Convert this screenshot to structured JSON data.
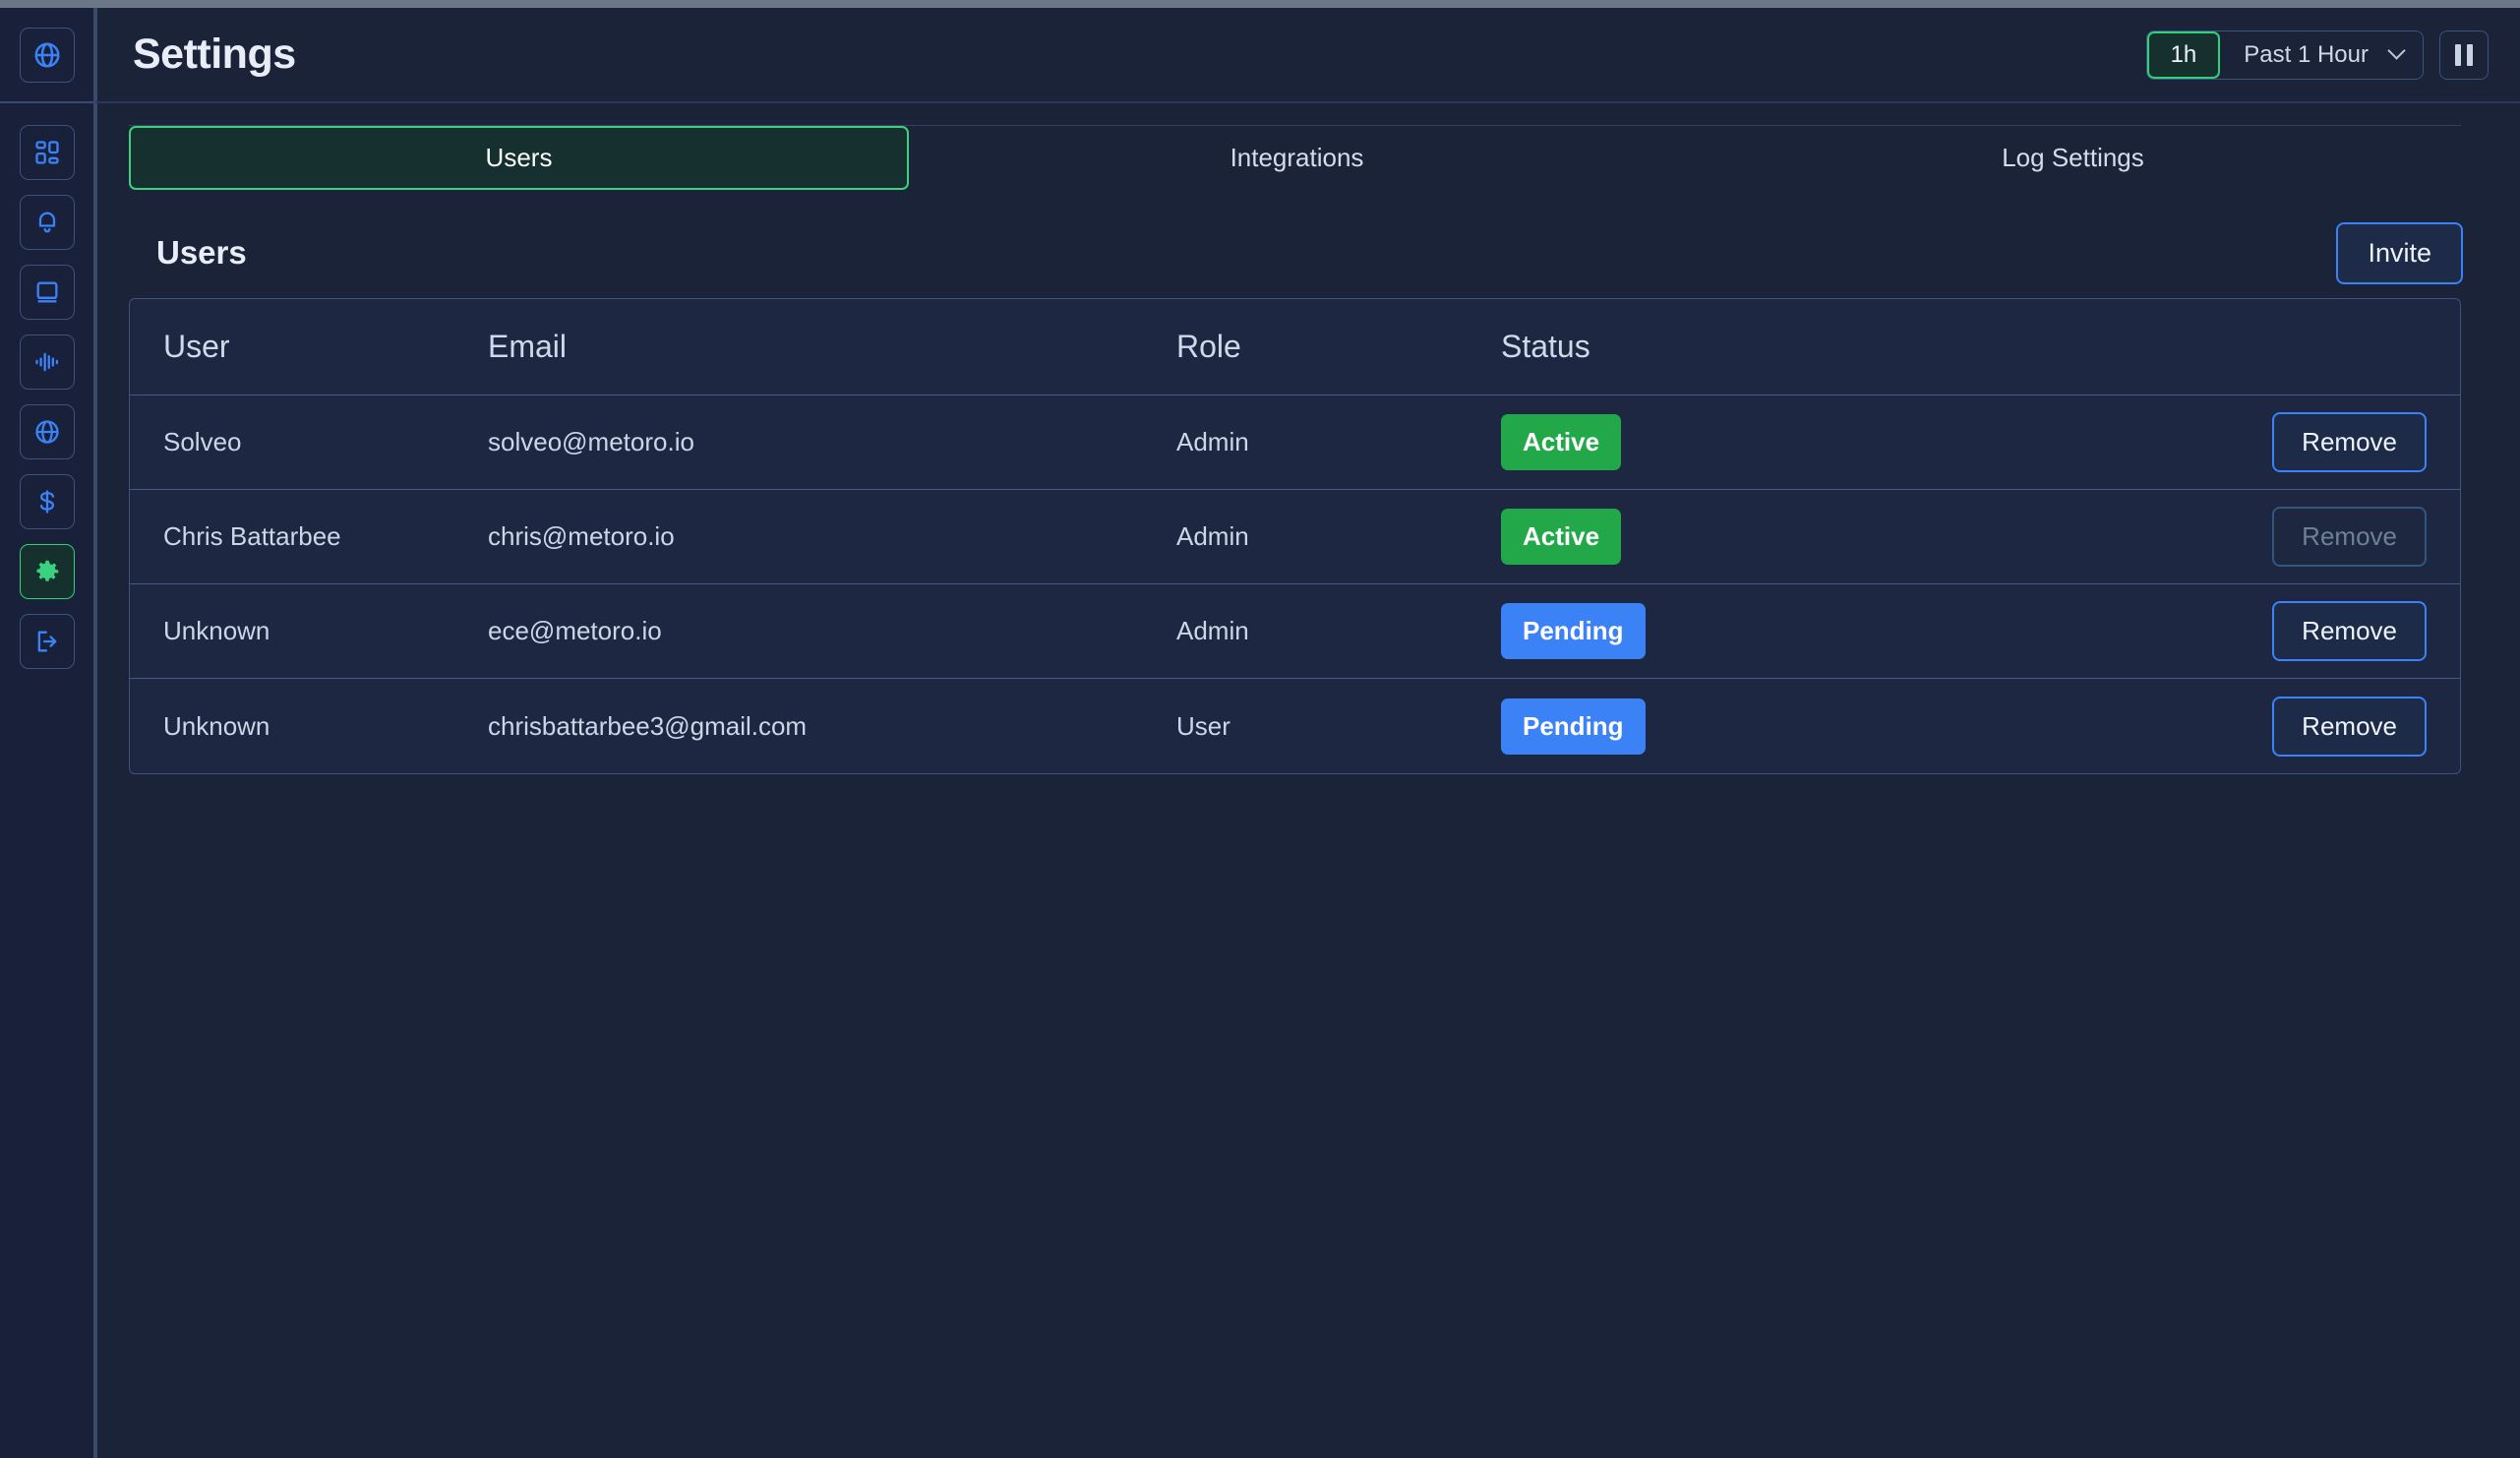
{
  "header": {
    "title": "Settings",
    "timerange": {
      "badge": "1h",
      "label": "Past 1 Hour",
      "chevron_icon": "chevron-down-icon"
    },
    "pause_icon": "pause-icon"
  },
  "sidebar": {
    "logo_icon": "globe-icon",
    "items": [
      {
        "icon": "dashboard-grid-icon",
        "active": false
      },
      {
        "icon": "bell-icon",
        "active": false
      },
      {
        "icon": "book-icon",
        "active": false
      },
      {
        "icon": "waveform-icon",
        "active": false
      },
      {
        "icon": "globe-icon",
        "active": false
      },
      {
        "icon": "dollar-icon",
        "active": false
      },
      {
        "icon": "gear-icon",
        "active": true
      },
      {
        "icon": "logout-icon",
        "active": false
      }
    ]
  },
  "tabs": [
    {
      "label": "Users",
      "active": true
    },
    {
      "label": "Integrations",
      "active": false
    },
    {
      "label": "Log Settings",
      "active": false
    }
  ],
  "section": {
    "title": "Users",
    "invite_label": "Invite"
  },
  "table": {
    "columns": [
      "User",
      "Email",
      "Role",
      "Status"
    ],
    "action_label": "Remove",
    "rows": [
      {
        "user": "Solveo",
        "email": "solveo@metoro.io",
        "role": "Admin",
        "status": "Active",
        "status_kind": "active",
        "action": "Remove",
        "action_disabled": false
      },
      {
        "user": "Chris Battarbee",
        "email": "chris@metoro.io",
        "role": "Admin",
        "status": "Active",
        "status_kind": "active",
        "action": "Remove",
        "action_disabled": true
      },
      {
        "user": "Unknown",
        "email": "ece@metoro.io",
        "role": "Admin",
        "status": "Pending",
        "status_kind": "pending",
        "action": "Remove",
        "action_disabled": false
      },
      {
        "user": "Unknown",
        "email": "chrisbattarbee3@gmail.com",
        "role": "User",
        "status": "Pending",
        "status_kind": "pending",
        "action": "Remove",
        "action_disabled": false
      }
    ]
  },
  "colors": {
    "page_bg": "#1a2338",
    "rail_bg": "#18203a",
    "card_bg": "#1d2742",
    "accent_green": "#3ad27f",
    "accent_blue": "#3b82f6",
    "status_active": "#22a848",
    "status_pending": "#3b82f6",
    "text_primary": "#e8edf7",
    "border": "#3d527e"
  }
}
